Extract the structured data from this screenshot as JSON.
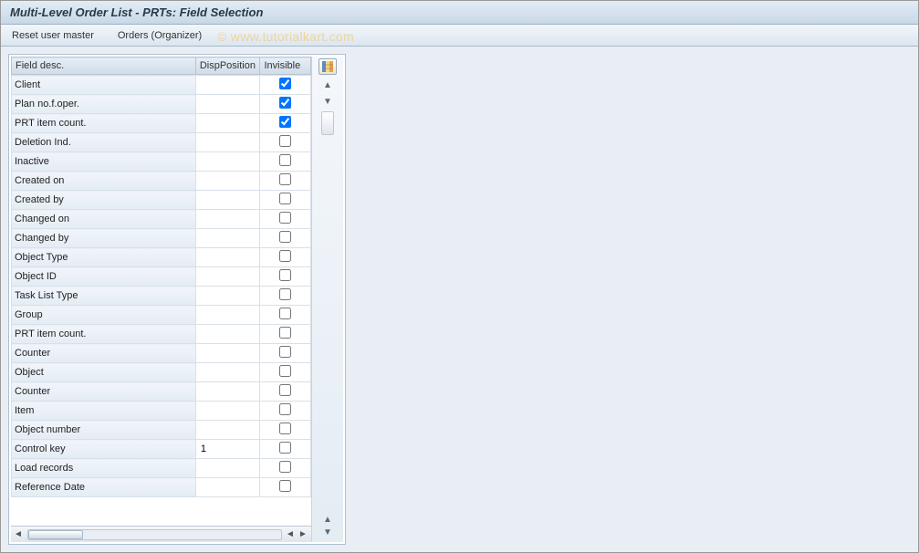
{
  "title": "Multi-Level Order List - PRTs: Field Selection",
  "menu": {
    "reset_user_master": "Reset user master",
    "orders_organizer": "Orders (Organizer)"
  },
  "watermark": "© www.tutorialkart.com",
  "table": {
    "headers": {
      "desc": "Field desc.",
      "pos": "DispPosition",
      "inv": "Invisible"
    },
    "rows": [
      {
        "desc": "Client",
        "pos": "",
        "inv": true
      },
      {
        "desc": "Plan no.f.oper.",
        "pos": "",
        "inv": true
      },
      {
        "desc": "PRT item count.",
        "pos": "",
        "inv": true
      },
      {
        "desc": "Deletion Ind.",
        "pos": "",
        "inv": false
      },
      {
        "desc": "Inactive",
        "pos": "",
        "inv": false
      },
      {
        "desc": "Created on",
        "pos": "",
        "inv": false
      },
      {
        "desc": "Created by",
        "pos": "",
        "inv": false
      },
      {
        "desc": "Changed on",
        "pos": "",
        "inv": false
      },
      {
        "desc": "Changed by",
        "pos": "",
        "inv": false
      },
      {
        "desc": "Object Type",
        "pos": "",
        "inv": false
      },
      {
        "desc": "Object ID",
        "pos": "",
        "inv": false
      },
      {
        "desc": "Task List Type",
        "pos": "",
        "inv": false
      },
      {
        "desc": "Group",
        "pos": "",
        "inv": false
      },
      {
        "desc": "PRT item count.",
        "pos": "",
        "inv": false
      },
      {
        "desc": "Counter",
        "pos": "",
        "inv": false
      },
      {
        "desc": "Object",
        "pos": "",
        "inv": false
      },
      {
        "desc": "Counter",
        "pos": "",
        "inv": false
      },
      {
        "desc": "Item",
        "pos": "",
        "inv": false
      },
      {
        "desc": "Object number",
        "pos": "",
        "inv": false
      },
      {
        "desc": "Control key",
        "pos": "1",
        "inv": false
      },
      {
        "desc": "Load records",
        "pos": "",
        "inv": false
      },
      {
        "desc": "Reference Date",
        "pos": "",
        "inv": false
      }
    ]
  },
  "icons": {
    "config": "table-settings-icon",
    "scroll_up": "▲",
    "scroll_down": "▼",
    "tri_left": "◄",
    "tri_right": "►"
  }
}
